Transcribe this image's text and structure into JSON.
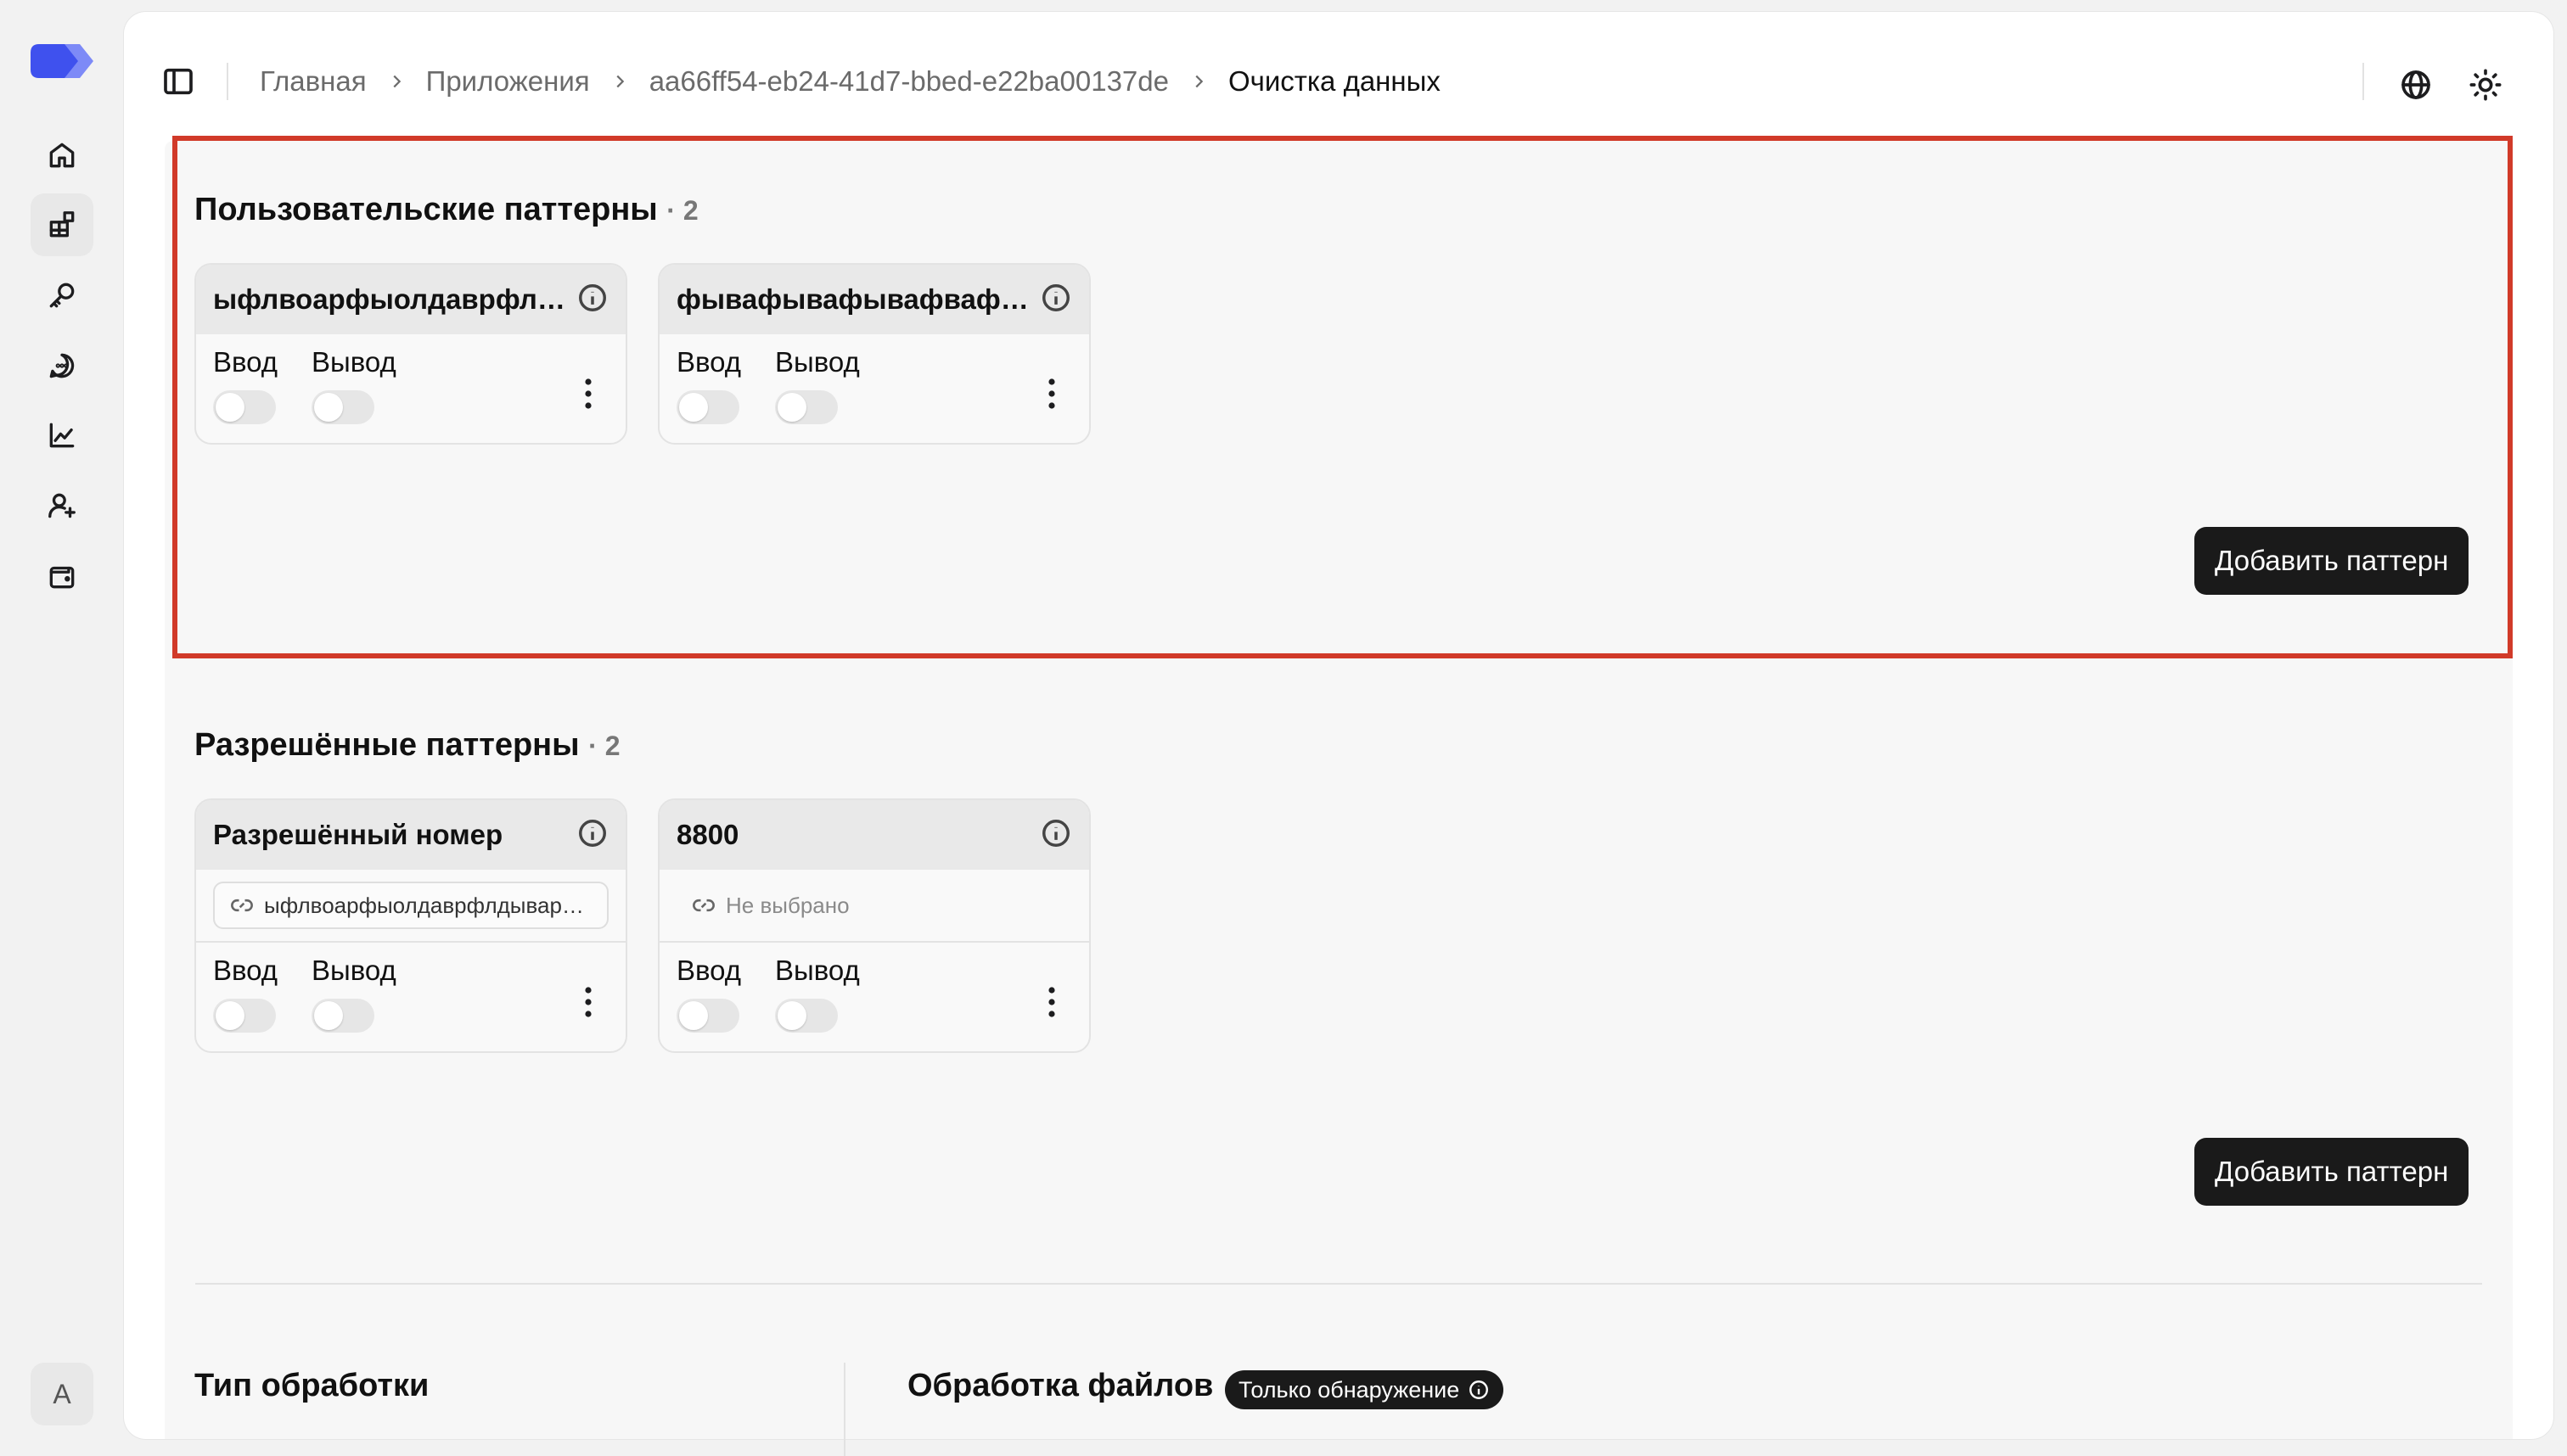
{
  "breadcrumb": {
    "home": "Главная",
    "apps": "Приложения",
    "app_id": "aa66ff54-eb24-41d7-bbed-e22ba00137de",
    "current": "Очистка данных"
  },
  "sidebar": {
    "avatar_initial": "A",
    "items": [
      "home-icon",
      "apps-icon",
      "key-icon",
      "chat-icon",
      "chart-icon",
      "user-add-icon",
      "wallet-icon"
    ]
  },
  "custom_patterns": {
    "title": "Пользовательские паттерны",
    "count": "· 2",
    "cards": [
      {
        "name": "ыфлвоарфыолдаврфлдыварфыварфыварфыв",
        "input_label": "Ввод",
        "output_label": "Вывод",
        "input_on": false,
        "output_on": false
      },
      {
        "name": "фывафывафывафвафывафывафывафыва",
        "input_label": "Ввод",
        "output_label": "Вывод",
        "input_on": false,
        "output_on": false
      }
    ],
    "add_button": "Добавить паттерн"
  },
  "allowed_patterns": {
    "title": "Разрешённые паттерны",
    "count": "· 2",
    "cards": [
      {
        "name": "Разрешённый номер",
        "linked": "ыфлвоарфыолдаврфлдыварфыварфыв",
        "input_label": "Ввод",
        "output_label": "Вывод",
        "input_on": false,
        "output_on": false
      },
      {
        "name": "8800",
        "linked": "Не выбрано",
        "input_label": "Ввод",
        "output_label": "Вывод",
        "input_on": false,
        "output_on": false
      }
    ],
    "add_button": "Добавить паттерн"
  },
  "processing": {
    "type_title": "Тип обработки",
    "files_title": "Обработка файлов",
    "files_badge": "Только обнаружение"
  },
  "colors": {
    "highlight": "#d13a29",
    "button": "#1a1a1a",
    "logo": "#4b5cf0"
  }
}
